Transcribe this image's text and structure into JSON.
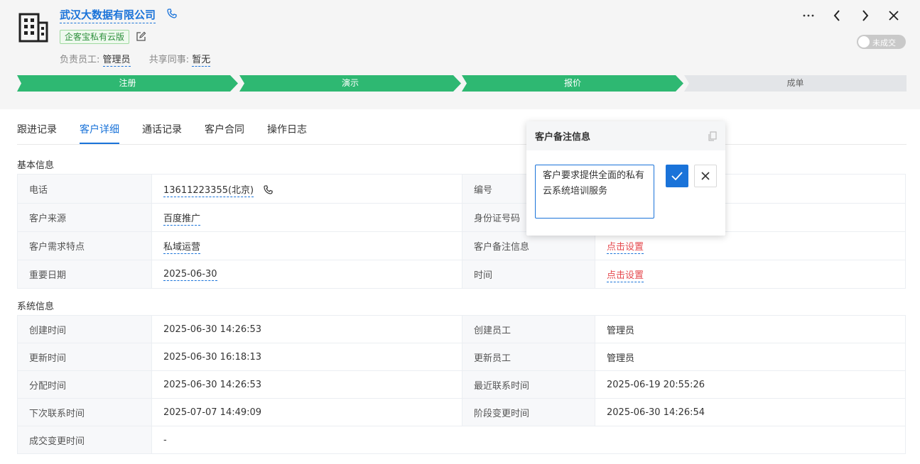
{
  "company": {
    "name": "武汉大数据有限公司",
    "edition": "企客宝私有云版",
    "owner_label": "负责员工:",
    "owner_value": "管理员",
    "share_label": "共享同事:",
    "share_value": "暂无",
    "deal_status": "未成交"
  },
  "stages": [
    {
      "label": "注册",
      "status": "done"
    },
    {
      "label": "演示",
      "status": "done"
    },
    {
      "label": "报价",
      "status": "done"
    },
    {
      "label": "成单",
      "status": "todo"
    }
  ],
  "tabs": [
    {
      "label": "跟进记录"
    },
    {
      "label": "客户详细",
      "active": true
    },
    {
      "label": "通话记录"
    },
    {
      "label": "客户合同"
    },
    {
      "label": "操作日志"
    }
  ],
  "basic": {
    "title": "基本信息",
    "rows": [
      {
        "k1": "电话",
        "v1": "13611223355(北京)",
        "k2": "编号",
        "v2": ""
      },
      {
        "k1": "客户来源",
        "v1": "百度推广",
        "k2": "身份证号码",
        "v2": ""
      },
      {
        "k1": "客户需求特点",
        "v1": "私域运营",
        "k2": "客户备注信息",
        "v2": "点击设置"
      },
      {
        "k1": "重要日期",
        "v1": "2025-06-30",
        "k2": "时间",
        "v2": "点击设置"
      }
    ]
  },
  "system": {
    "title": "系统信息",
    "rows": [
      {
        "k1": "创建时间",
        "v1": "2025-06-30 14:26:53",
        "k2": "创建员工",
        "v2": "管理员"
      },
      {
        "k1": "更新时间",
        "v1": "2025-06-30 16:18:13",
        "k2": "更新员工",
        "v2": "管理员"
      },
      {
        "k1": "分配时间",
        "v1": "2025-06-30 14:26:53",
        "k2": "最近联系时间",
        "v2": "2025-06-19 20:55:26"
      },
      {
        "k1": "下次联系时间",
        "v1": "2025-07-07 14:49:09",
        "k2": "阶段变更时间",
        "v2": "2025-06-30 14:26:54"
      },
      {
        "k1": "成交变更时间",
        "v1": "-"
      }
    ]
  },
  "popup": {
    "title": "客户备注信息",
    "text": "客户要求提供全面的私有云系统培训服务"
  },
  "colors": {
    "accent": "#1a73d9",
    "stage_done": "#2eb872",
    "link_red": "#e5484d"
  }
}
